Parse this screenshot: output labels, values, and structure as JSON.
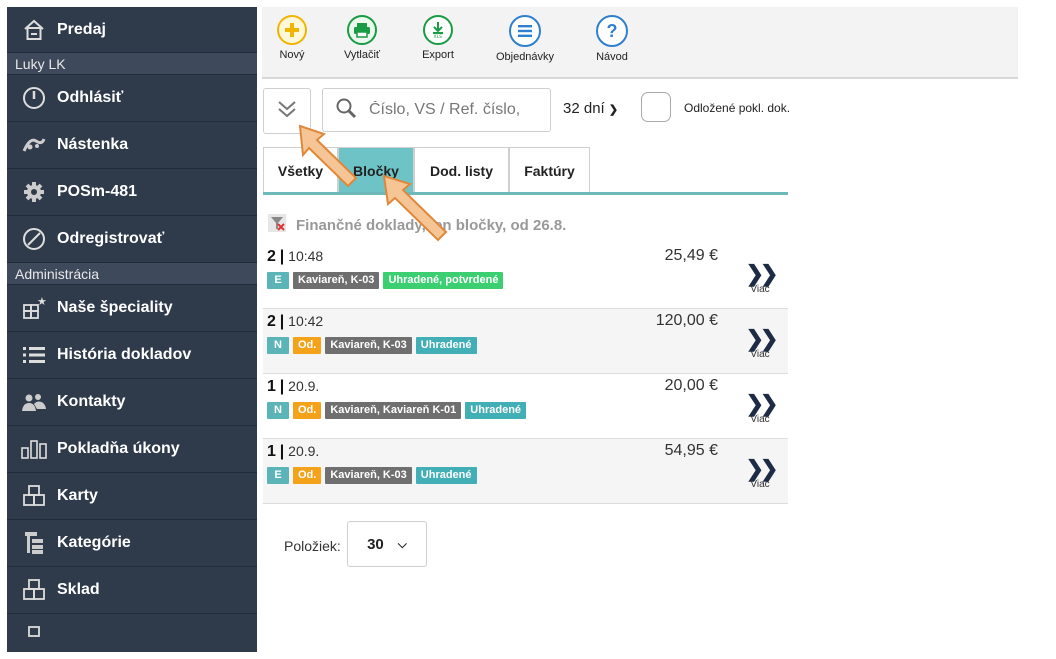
{
  "sidebar": {
    "items": [
      {
        "label": "Predaj",
        "icon": "home-icon"
      },
      {
        "section": "Luky LK"
      },
      {
        "label": "Odhlásiť",
        "icon": "power-icon"
      },
      {
        "label": "Nástenka",
        "icon": "dashboard-icon"
      },
      {
        "label": "POSm-481",
        "icon": "gear-icon"
      },
      {
        "label": "Odregistrovať",
        "icon": "ban-icon"
      },
      {
        "section": "Administrácia"
      },
      {
        "label": "Naše špeciality",
        "icon": "specials-icon"
      },
      {
        "label": "História dokladov",
        "icon": "list-icon"
      },
      {
        "label": "Kontakty",
        "icon": "users-icon"
      },
      {
        "label": "Pokladňa úkony",
        "icon": "cash-icon"
      },
      {
        "label": "Karty",
        "icon": "cards-icon"
      },
      {
        "label": "Kategórie",
        "icon": "categories-icon"
      },
      {
        "label": "Sklad",
        "icon": "warehouse-icon"
      }
    ]
  },
  "toolbar": {
    "new_label": "Nový",
    "print_label": "Vytlačiť",
    "export_label": "Export",
    "orders_label": "Objednávky",
    "help_label": "Návod"
  },
  "filters": {
    "search_placeholder": "Číslo, VS / Ref. číslo,",
    "days": "32 dní",
    "deferred_label": "Odložené pokl. dok."
  },
  "tabs": [
    {
      "label": "Všetky",
      "active": false
    },
    {
      "label": "Bločky",
      "active": true
    },
    {
      "label": "Dod. listy",
      "active": false
    },
    {
      "label": "Faktúry",
      "active": false
    }
  ],
  "filter_note": "Finančné doklady, len bločky, od 26.8.",
  "documents": [
    {
      "num": "2",
      "time": "10:48",
      "amount": "25,49 €",
      "type": "E",
      "od": "",
      "place": "Kaviareň, K-03",
      "status": "Uhradené, potvrdené",
      "status_color": "#3ccf72",
      "more": "Viac"
    },
    {
      "num": "2",
      "time": "10:42",
      "amount": "120,00 €",
      "type": "N",
      "od": "Od.",
      "place": "Kaviareň, K-03",
      "status": "Uhradené",
      "status_color": "#42aeb6",
      "more": "Viac"
    },
    {
      "num": "1",
      "time": "20.9.",
      "amount": "20,00 €",
      "type": "N",
      "od": "Od.",
      "place": "Kaviareň, Kaviareň K-01",
      "status": "Uhradené",
      "status_color": "#42aeb6",
      "more": "Viac"
    },
    {
      "num": "1",
      "time": "20.9.",
      "amount": "54,95 €",
      "type": "E",
      "od": "Od.",
      "place": "Kaviareň, K-03",
      "status": "Uhradené",
      "status_color": "#42aeb6",
      "more": "Viac"
    }
  ],
  "pagination": {
    "label": "Položiek:",
    "value": "30"
  },
  "colors": {
    "sidebar_bg": "#2f3a4b",
    "accent_teal": "#6ec3c6",
    "badge_orange": "#f4a21a",
    "badge_green": "#3ccf72"
  }
}
